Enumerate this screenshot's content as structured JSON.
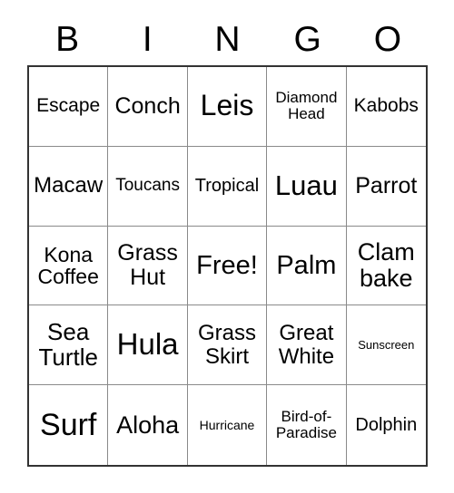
{
  "card": {
    "title": "BINGO",
    "header_letters": [
      "B",
      "I",
      "N",
      "G",
      "O"
    ],
    "border_color": "#333333",
    "grid_line_color": "#8a8a8a",
    "text_color": "#000000",
    "background_color": "#ffffff",
    "columns": 5,
    "rows": 5,
    "free_space_label": "Free!",
    "free_space_position": "center"
  },
  "cells": [
    {
      "text": "Escape",
      "size": 21,
      "row": 1,
      "col": 1
    },
    {
      "text": "Conch",
      "size": 25,
      "row": 1,
      "col": 2
    },
    {
      "text": "Leis",
      "size": 32,
      "row": 1,
      "col": 3
    },
    {
      "text": "Diamond\nHead",
      "size": 17,
      "row": 1,
      "col": 4
    },
    {
      "text": "Kabobs",
      "size": 21,
      "row": 1,
      "col": 5
    },
    {
      "text": "Macaw",
      "size": 24,
      "row": 2,
      "col": 1
    },
    {
      "text": "Toucans",
      "size": 19,
      "row": 2,
      "col": 2
    },
    {
      "text": "Tropical",
      "size": 20,
      "row": 2,
      "col": 3
    },
    {
      "text": "Luau",
      "size": 31,
      "row": 2,
      "col": 4
    },
    {
      "text": "Parrot",
      "size": 25,
      "row": 2,
      "col": 5
    },
    {
      "text": "Kona\nCoffee",
      "size": 23,
      "row": 3,
      "col": 1
    },
    {
      "text": "Grass\nHut",
      "size": 25,
      "row": 3,
      "col": 2
    },
    {
      "text": "Free!",
      "size": 29,
      "row": 3,
      "col": 3
    },
    {
      "text": "Palm",
      "size": 29,
      "row": 3,
      "col": 4
    },
    {
      "text": "Clam\nbake",
      "size": 27,
      "row": 3,
      "col": 5
    },
    {
      "text": "Sea\nTurtle",
      "size": 26,
      "row": 4,
      "col": 1
    },
    {
      "text": "Hula",
      "size": 33,
      "row": 4,
      "col": 2
    },
    {
      "text": "Grass\nSkirt",
      "size": 24,
      "row": 4,
      "col": 3
    },
    {
      "text": "Great\nWhite",
      "size": 24,
      "row": 4,
      "col": 4
    },
    {
      "text": "Sunscreen",
      "size": 13,
      "row": 4,
      "col": 5
    },
    {
      "text": "Surf",
      "size": 34,
      "row": 5,
      "col": 1
    },
    {
      "text": "Aloha",
      "size": 27,
      "row": 5,
      "col": 2
    },
    {
      "text": "Hurricane",
      "size": 14,
      "row": 5,
      "col": 3
    },
    {
      "text": "Bird-of-\nParadise",
      "size": 17,
      "row": 5,
      "col": 4
    },
    {
      "text": "Dolphin",
      "size": 20,
      "row": 5,
      "col": 5
    }
  ]
}
